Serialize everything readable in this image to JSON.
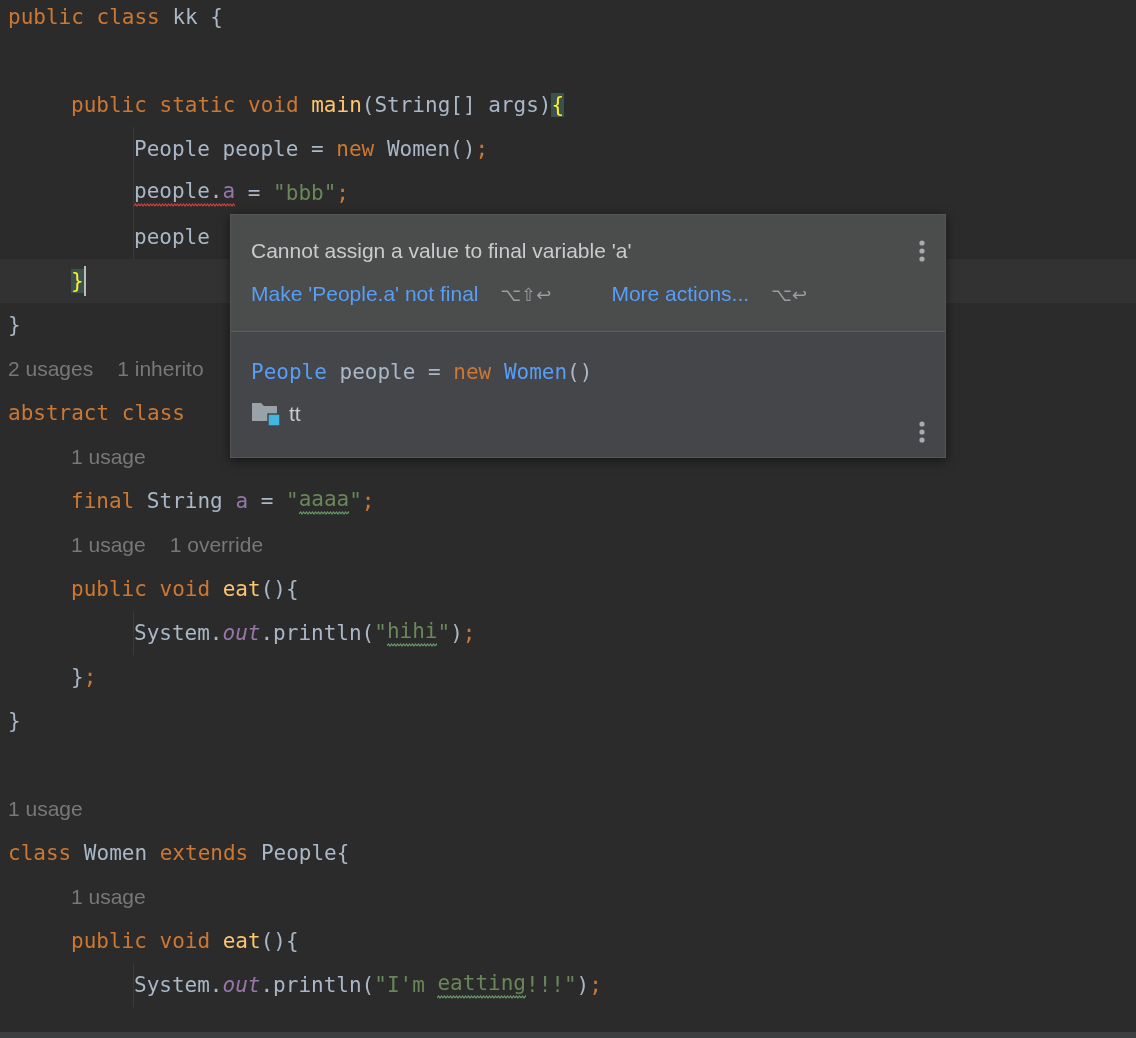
{
  "editor": {
    "lines": [
      {
        "kind": "code",
        "tokens": [
          {
            "text": "public class ",
            "kind": "keyword"
          },
          {
            "text": "kk {",
            "kind": "plain"
          }
        ],
        "children": [
          {
            "kind": "blank"
          },
          {
            "kind": "code",
            "tokens": [
              {
                "text": "public static void ",
                "kind": "keyword"
              },
              {
                "text": "main",
                "kind": "method"
              },
              {
                "text": "(String[] args)",
                "kind": "plain"
              },
              {
                "text": "{",
                "kind": "brace-match"
              }
            ],
            "children": [
              {
                "kind": "code",
                "tokens": [
                  {
                    "text": "People people = ",
                    "kind": "plain"
                  },
                  {
                    "text": "new ",
                    "kind": "keyword"
                  },
                  {
                    "text": "Women()",
                    "kind": "plain"
                  },
                  {
                    "text": ";",
                    "kind": "keyword"
                  }
                ]
              },
              {
                "kind": "code",
                "tokens": [
                  {
                    "text": "people.",
                    "kind": "plain",
                    "error": true
                  },
                  {
                    "text": "a",
                    "kind": "field",
                    "error": true
                  },
                  {
                    "text": " = ",
                    "kind": "plain"
                  },
                  {
                    "text": "\"bbb\"",
                    "kind": "string"
                  },
                  {
                    "text": ";",
                    "kind": "keyword"
                  }
                ]
              },
              {
                "kind": "code",
                "tokens": [
                  {
                    "text": "people",
                    "kind": "plain"
                  }
                ]
              }
            ]
          },
          {
            "kind": "code",
            "current": true,
            "tokens": [
              {
                "text": "}",
                "kind": "brace-match"
              }
            ]
          }
        ]
      },
      {
        "kind": "code",
        "tokens": [
          {
            "text": "}",
            "kind": "plain"
          }
        ]
      },
      {
        "kind": "hints",
        "hints": [
          "2 usages",
          "1 inherito"
        ]
      },
      {
        "kind": "code",
        "tokens": [
          {
            "text": "abstract class",
            "kind": "keyword"
          }
        ],
        "children": [
          {
            "kind": "hints",
            "hints": [
              "1 usage"
            ]
          },
          {
            "kind": "code",
            "tokens": [
              {
                "text": "final ",
                "kind": "keyword"
              },
              {
                "text": "String ",
                "kind": "plain"
              },
              {
                "text": "a",
                "kind": "field"
              },
              {
                "text": " = ",
                "kind": "plain"
              },
              {
                "text": "\"",
                "kind": "string"
              },
              {
                "text": "aaaa",
                "kind": "string",
                "typo": true
              },
              {
                "text": "\"",
                "kind": "string"
              },
              {
                "text": ";",
                "kind": "keyword"
              }
            ]
          },
          {
            "kind": "hints",
            "hints": [
              "1 usage",
              "1 override"
            ]
          },
          {
            "kind": "code",
            "tokens": [
              {
                "text": "public void ",
                "kind": "keyword"
              },
              {
                "text": "eat",
                "kind": "method"
              },
              {
                "text": "(){",
                "kind": "plain"
              }
            ],
            "children": [
              {
                "kind": "code",
                "tokens": [
                  {
                    "text": "System.",
                    "kind": "plain"
                  },
                  {
                    "text": "out",
                    "kind": "static-field"
                  },
                  {
                    "text": ".println(",
                    "kind": "plain"
                  },
                  {
                    "text": "\"",
                    "kind": "string"
                  },
                  {
                    "text": "hihi",
                    "kind": "string",
                    "typo": true
                  },
                  {
                    "text": "\"",
                    "kind": "string"
                  },
                  {
                    "text": ")",
                    "kind": "plain"
                  },
                  {
                    "text": ";",
                    "kind": "keyword"
                  }
                ]
              }
            ]
          },
          {
            "kind": "code",
            "tokens": [
              {
                "text": "}",
                "kind": "plain"
              },
              {
                "text": ";",
                "kind": "keyword"
              }
            ]
          }
        ]
      },
      {
        "kind": "code",
        "tokens": [
          {
            "text": "}",
            "kind": "plain"
          }
        ]
      },
      {
        "kind": "blank"
      },
      {
        "kind": "hints",
        "hints": [
          "1 usage"
        ]
      },
      {
        "kind": "code",
        "tokens": [
          {
            "text": "class ",
            "kind": "keyword"
          },
          {
            "text": "Women ",
            "kind": "plain"
          },
          {
            "text": "extends ",
            "kind": "keyword"
          },
          {
            "text": "People{",
            "kind": "plain"
          }
        ],
        "children": [
          {
            "kind": "hints",
            "hints": [
              "1 usage"
            ]
          },
          {
            "kind": "code",
            "tokens": [
              {
                "text": "public void ",
                "kind": "keyword"
              },
              {
                "text": "eat",
                "kind": "method"
              },
              {
                "text": "(){",
                "kind": "plain"
              }
            ],
            "children": [
              {
                "kind": "code",
                "tokens": [
                  {
                    "text": "System.",
                    "kind": "plain"
                  },
                  {
                    "text": "out",
                    "kind": "static-field"
                  },
                  {
                    "text": ".println(",
                    "kind": "plain"
                  },
                  {
                    "text": "\"I'm ",
                    "kind": "string"
                  },
                  {
                    "text": "eatting",
                    "kind": "string",
                    "typo": true
                  },
                  {
                    "text": "!!!\"",
                    "kind": "string"
                  },
                  {
                    "text": ")",
                    "kind": "plain"
                  },
                  {
                    "text": ";",
                    "kind": "keyword"
                  }
                ]
              }
            ]
          }
        ]
      }
    ]
  },
  "popup": {
    "message": "Cannot assign a value to final variable 'a'",
    "actions": [
      {
        "label": "Make 'People.a' not final",
        "shortcut": "⌥⇧↩"
      },
      {
        "label": "More actions...",
        "shortcut": "⌥↩"
      }
    ],
    "preview": {
      "tokens": [
        {
          "text": "People",
          "kind": "class-ref"
        },
        {
          "text": " people = ",
          "kind": "plain"
        },
        {
          "text": "new ",
          "kind": "keyword"
        },
        {
          "text": "Women",
          "kind": "class-ref"
        },
        {
          "text": "()",
          "kind": "plain"
        }
      ]
    },
    "location": "tt"
  }
}
